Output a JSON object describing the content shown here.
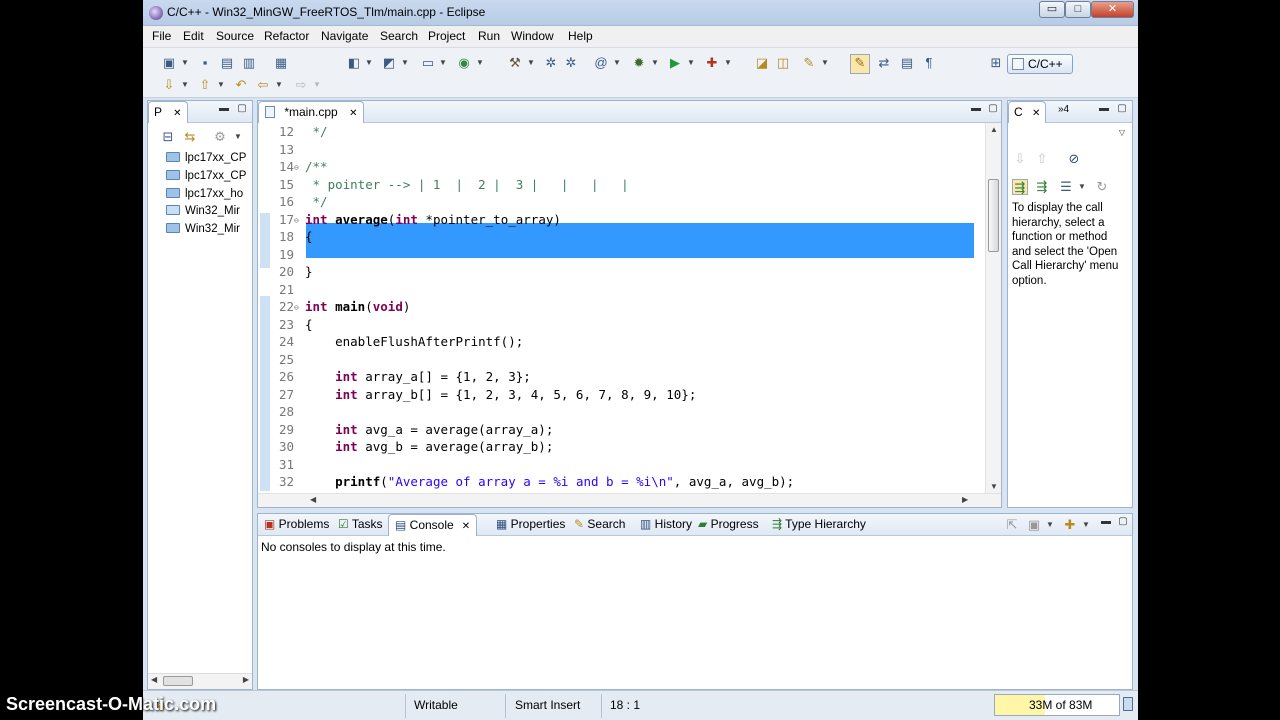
{
  "window": {
    "title": "C/C++ - Win32_MinGW_FreeRTOS_Tlm/main.cpp - Eclipse",
    "min_symbol": "▭",
    "max_symbol": "□",
    "close_symbol": "✕"
  },
  "menubar": [
    "File",
    "Edit",
    "Source",
    "Refactor",
    "Navigate",
    "Search",
    "Project",
    "Run",
    "Window",
    "Help"
  ],
  "toolbar": {
    "perspective_label": "C/C++"
  },
  "project_explorer": {
    "tab_label": "P",
    "items": [
      "lpc17xx_CP",
      "lpc17xx_CP",
      "lpc17xx_ho",
      "Win32_Mir",
      "Win32_Mir"
    ]
  },
  "editor": {
    "tab_label": "*main.cpp",
    "lines": [
      {
        "n": "12",
        "fold": "",
        "segs": [
          {
            "t": " */",
            "c": "comment"
          }
        ]
      },
      {
        "n": "13",
        "fold": "",
        "segs": [
          {
            "t": "",
            "c": "code"
          }
        ]
      },
      {
        "n": "14",
        "fold": "⊖",
        "segs": [
          {
            "t": "/**",
            "c": "comment"
          }
        ]
      },
      {
        "n": "15",
        "fold": "",
        "segs": [
          {
            "t": " * pointer --> | 1  |  2 |  3 |   |   |   |",
            "c": "comment"
          }
        ]
      },
      {
        "n": "16",
        "fold": "",
        "segs": [
          {
            "t": " */",
            "c": "comment"
          }
        ]
      },
      {
        "n": "17",
        "fold": "⊖",
        "segs": [
          {
            "t": "int",
            "c": "kw"
          },
          {
            "t": " ",
            "c": "code"
          },
          {
            "t": "average",
            "c": "fn"
          },
          {
            "t": "(",
            "c": "code"
          },
          {
            "t": "int",
            "c": "kw"
          },
          {
            "t": " *pointer_to_array)",
            "c": "code"
          }
        ]
      },
      {
        "n": "18",
        "fold": "",
        "segs": [
          {
            "t": "{",
            "c": "code"
          }
        ]
      },
      {
        "n": "19",
        "fold": "",
        "segs": [
          {
            "t": "",
            "c": "code"
          }
        ]
      },
      {
        "n": "20",
        "fold": "",
        "segs": [
          {
            "t": "}",
            "c": "code"
          }
        ]
      },
      {
        "n": "21",
        "fold": "",
        "segs": [
          {
            "t": "",
            "c": "code"
          }
        ]
      },
      {
        "n": "22",
        "fold": "⊖",
        "segs": [
          {
            "t": "int",
            "c": "kw"
          },
          {
            "t": " ",
            "c": "code"
          },
          {
            "t": "main",
            "c": "fn"
          },
          {
            "t": "(",
            "c": "code"
          },
          {
            "t": "void",
            "c": "kw"
          },
          {
            "t": ")",
            "c": "code"
          }
        ]
      },
      {
        "n": "23",
        "fold": "",
        "segs": [
          {
            "t": "{",
            "c": "code"
          }
        ]
      },
      {
        "n": "24",
        "fold": "",
        "segs": [
          {
            "t": "    enableFlushAfterPrintf();",
            "c": "code"
          }
        ]
      },
      {
        "n": "25",
        "fold": "",
        "segs": [
          {
            "t": "",
            "c": "code"
          }
        ]
      },
      {
        "n": "26",
        "fold": "",
        "segs": [
          {
            "t": "    ",
            "c": "code"
          },
          {
            "t": "int",
            "c": "kw"
          },
          {
            "t": " array_a[] = {1, 2, 3};",
            "c": "code"
          }
        ]
      },
      {
        "n": "27",
        "fold": "",
        "segs": [
          {
            "t": "    ",
            "c": "code"
          },
          {
            "t": "int",
            "c": "kw"
          },
          {
            "t": " array_b[] = {1, 2, 3, 4, 5, 6, 7, 8, 9, 10};",
            "c": "code"
          }
        ]
      },
      {
        "n": "28",
        "fold": "",
        "segs": [
          {
            "t": "",
            "c": "code"
          }
        ]
      },
      {
        "n": "29",
        "fold": "",
        "segs": [
          {
            "t": "    ",
            "c": "code"
          },
          {
            "t": "int",
            "c": "kw"
          },
          {
            "t": " avg_a = average(array_a);",
            "c": "code"
          }
        ]
      },
      {
        "n": "30",
        "fold": "",
        "segs": [
          {
            "t": "    ",
            "c": "code"
          },
          {
            "t": "int",
            "c": "kw"
          },
          {
            "t": " avg_b = average(array_b);",
            "c": "code"
          }
        ]
      },
      {
        "n": "31",
        "fold": "",
        "segs": [
          {
            "t": "",
            "c": "code"
          }
        ]
      },
      {
        "n": "32",
        "fold": "",
        "segs": [
          {
            "t": "    ",
            "c": "code"
          },
          {
            "t": "printf",
            "c": "fn"
          },
          {
            "t": "(",
            "c": "code"
          },
          {
            "t": "\"Average of array a = %i and b = %i\\n\"",
            "c": "str"
          },
          {
            "t": ", avg_a, avg_b);",
            "c": "code"
          }
        ]
      }
    ]
  },
  "call_hierarchy": {
    "tab_label": "C",
    "overflow_label": "»4",
    "hint": "To display the call hierarchy, select a function or method and select the 'Open Call Hierarchy' menu option."
  },
  "bottom_panel": {
    "tabs": [
      "Problems",
      "Tasks",
      "Console",
      "Properties",
      "Search",
      "History",
      "Progress",
      "Type Hierarchy"
    ],
    "active_tab": "Console",
    "message": "No consoles to display at this time."
  },
  "statusbar": {
    "mode": "Writable",
    "insert": "Smart Insert",
    "position": "18 : 1",
    "heap": "33M of 83M",
    "heap_fraction": 0.4
  },
  "watermark": "Screencast-O-Matic.com",
  "colors": {
    "selection": "#3399ff",
    "keyword": "#7f0055",
    "comment": "#3f7f5f",
    "string": "#2a00ff"
  }
}
